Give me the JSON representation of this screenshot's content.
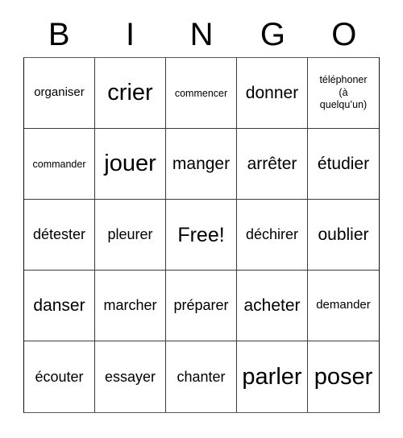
{
  "card": {
    "title": "BINGO",
    "header_letters": [
      "B",
      "I",
      "N",
      "G",
      "O"
    ],
    "free_space_label": "Free!",
    "rows": [
      [
        {
          "text": "organiser",
          "size": "xs"
        },
        {
          "text": "crier",
          "size": "xl"
        },
        {
          "text": "commencer",
          "size": "xxs"
        },
        {
          "text": "donner",
          "size": "md"
        },
        {
          "text": "téléphoner\n(à\nquelqu’un)",
          "size": "multi"
        }
      ],
      [
        {
          "text": "commander",
          "size": "xxs"
        },
        {
          "text": "jouer",
          "size": "xl"
        },
        {
          "text": "manger",
          "size": "md"
        },
        {
          "text": "arrêter",
          "size": "md"
        },
        {
          "text": "étudier",
          "size": "md"
        }
      ],
      [
        {
          "text": "détester",
          "size": "sm"
        },
        {
          "text": "pleurer",
          "size": "sm"
        },
        {
          "text": "Free!",
          "size": "lg"
        },
        {
          "text": "déchirer",
          "size": "sm"
        },
        {
          "text": "oublier",
          "size": "md"
        }
      ],
      [
        {
          "text": "danser",
          "size": "md"
        },
        {
          "text": "marcher",
          "size": "sm"
        },
        {
          "text": "préparer",
          "size": "sm"
        },
        {
          "text": "acheter",
          "size": "md"
        },
        {
          "text": "demander",
          "size": "xs"
        }
      ],
      [
        {
          "text": "écouter",
          "size": "sm"
        },
        {
          "text": "essayer",
          "size": "sm"
        },
        {
          "text": "chanter",
          "size": "sm"
        },
        {
          "text": "parler",
          "size": "xl"
        },
        {
          "text": "poser",
          "size": "xl"
        }
      ]
    ]
  },
  "colors": {
    "background": "#ffffff",
    "text": "#000000",
    "grid_line": "#3a3a3a",
    "grid_border": "#111111"
  }
}
